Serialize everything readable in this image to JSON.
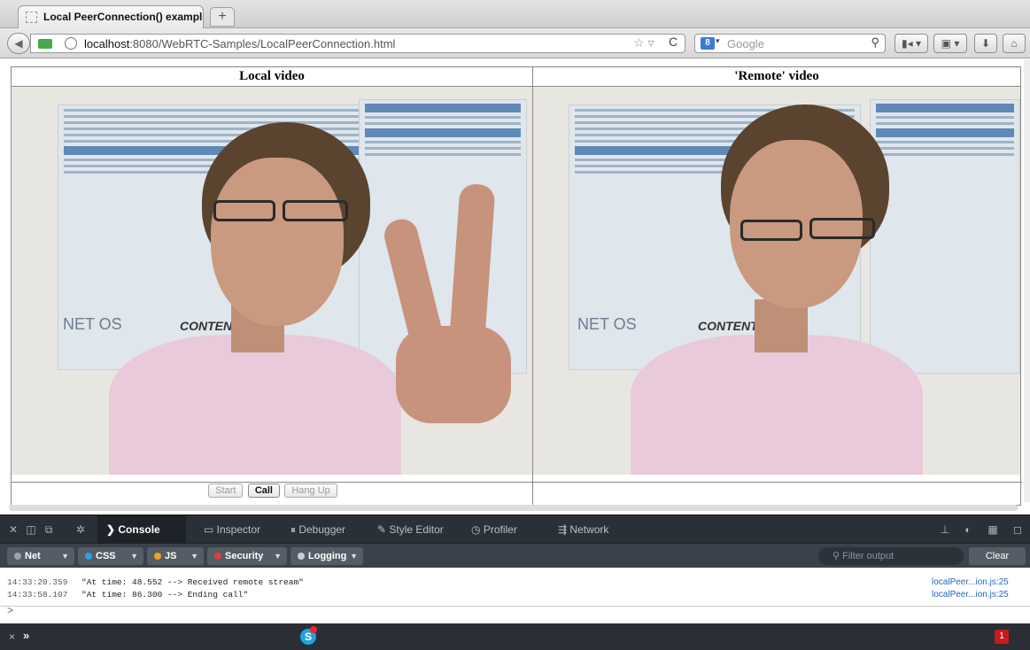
{
  "browser": {
    "tab_title": "Local PeerConnection() example",
    "new_tab_label": "+",
    "url_host": "localhost",
    "url_rest": ":8080/WebRTC-Samples/LocalPeerConnection.html",
    "search_placeholder": "Google",
    "search_engine_letter": "8"
  },
  "page": {
    "local_heading": "Local video",
    "remote_heading": "'Remote' video",
    "buttons": {
      "start": "Start",
      "call": "Call",
      "hangup": "Hang Up"
    },
    "poster_logos": {
      "netos": "NET OS",
      "content": "CONTENT"
    }
  },
  "devtools": {
    "tabs": [
      "Console",
      "Inspector",
      "Debugger",
      "Style Editor",
      "Profiler",
      "Network"
    ],
    "active_tab": "Console",
    "filters": [
      {
        "label": "Net",
        "color": "#9aa3ad"
      },
      {
        "label": "CSS",
        "color": "#2ba0e6"
      },
      {
        "label": "JS",
        "color": "#f0a21b"
      },
      {
        "label": "Security",
        "color": "#e33d3d"
      },
      {
        "label": "Logging",
        "color": "#c9ced4"
      }
    ],
    "filter_placeholder": "Filter output",
    "clear_label": "Clear",
    "console_rows": [
      {
        "time": "14:33:20.359",
        "message": "\"At time: 48.552 --> Received remote stream\"",
        "source": "localPeer...ion.js:25"
      },
      {
        "time": "14:33:58.107",
        "message": "\"At time: 86.300 --> Ending call\"",
        "source": "localPeer...ion.js:25"
      }
    ],
    "prompt": ">"
  },
  "addon_bar": {
    "close": "×",
    "chevrons": "»",
    "skype_letter": "S",
    "error_count": "1"
  }
}
